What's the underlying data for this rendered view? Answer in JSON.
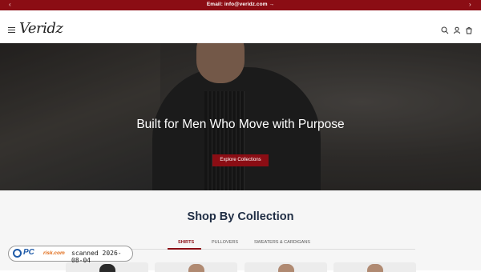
{
  "announcement": {
    "text": "Email: info@veridz.com →",
    "prev": "‹",
    "next": "›"
  },
  "header": {
    "logo": "Veridz",
    "menu_icon": "hamburger-icon",
    "icons": [
      "search-icon",
      "account-icon",
      "cart-icon"
    ]
  },
  "hero": {
    "title": "Built for Men Who Move with Purpose",
    "cta": "Explore Collections"
  },
  "collections": {
    "title": "Shop By Collection",
    "tabs": [
      {
        "label": "SHIRTS",
        "active": true
      },
      {
        "label": "PULLOVERS",
        "active": false
      },
      {
        "label": "SWEATERS & CARDIGANS",
        "active": false
      }
    ]
  },
  "badge": {
    "brand_a": "PC",
    "brand_b": "risk.com",
    "text": "scanned 2026-08-04"
  },
  "colors": {
    "accent": "#8b0d14",
    "heading": "#1f2d44"
  }
}
